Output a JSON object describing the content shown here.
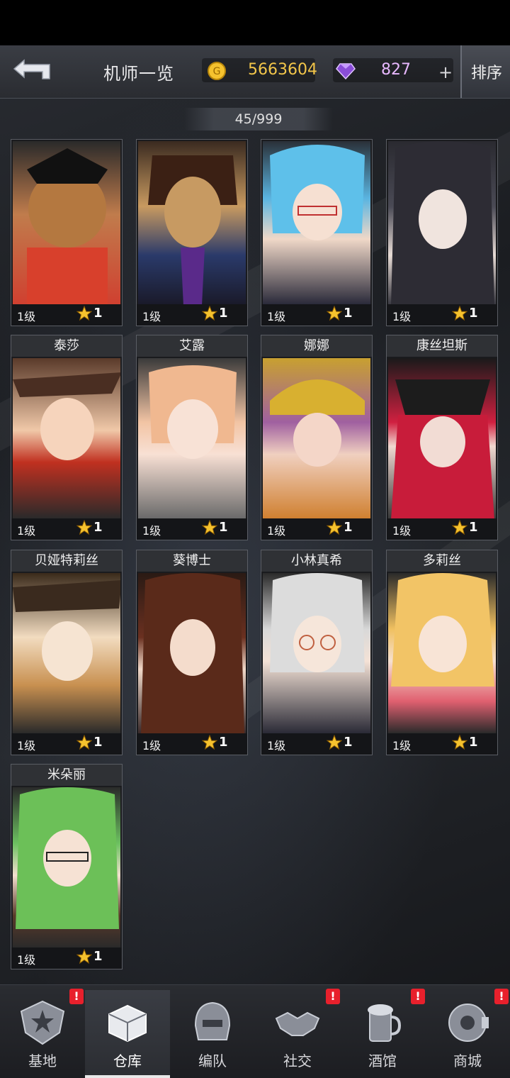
{
  "header": {
    "title": "机师一览",
    "gold": "5663604",
    "gems": "827",
    "plus": "+",
    "sort_label": "排序"
  },
  "roster": {
    "count": "45/999"
  },
  "cards": [
    {
      "name": "",
      "level": "1级",
      "stars": "1"
    },
    {
      "name": "",
      "level": "1级",
      "stars": "1"
    },
    {
      "name": "",
      "level": "1级",
      "stars": "1"
    },
    {
      "name": "",
      "level": "1级",
      "stars": "1"
    },
    {
      "name": "泰莎",
      "level": "1级",
      "stars": "1"
    },
    {
      "name": "艾露",
      "level": "1级",
      "stars": "1"
    },
    {
      "name": "娜娜",
      "level": "1级",
      "stars": "1"
    },
    {
      "name": "康丝坦斯",
      "level": "1级",
      "stars": "1"
    },
    {
      "name": "贝娅特莉丝",
      "level": "1级",
      "stars": "1"
    },
    {
      "name": "葵博士",
      "level": "1级",
      "stars": "1"
    },
    {
      "name": "小林真希",
      "level": "1级",
      "stars": "1"
    },
    {
      "name": "多莉丝",
      "level": "1级",
      "stars": "1"
    },
    {
      "name": "米朵丽",
      "level": "1级",
      "stars": "1"
    }
  ],
  "nav": {
    "base": "基地",
    "warehouse": "仓库",
    "formation": "编队",
    "social": "社交",
    "tavern": "酒馆",
    "shop": "商城",
    "badge": "!"
  },
  "colors": {
    "gold": "#f3c64a",
    "gem": "#e8b8ff",
    "badge": "#e8202c"
  }
}
